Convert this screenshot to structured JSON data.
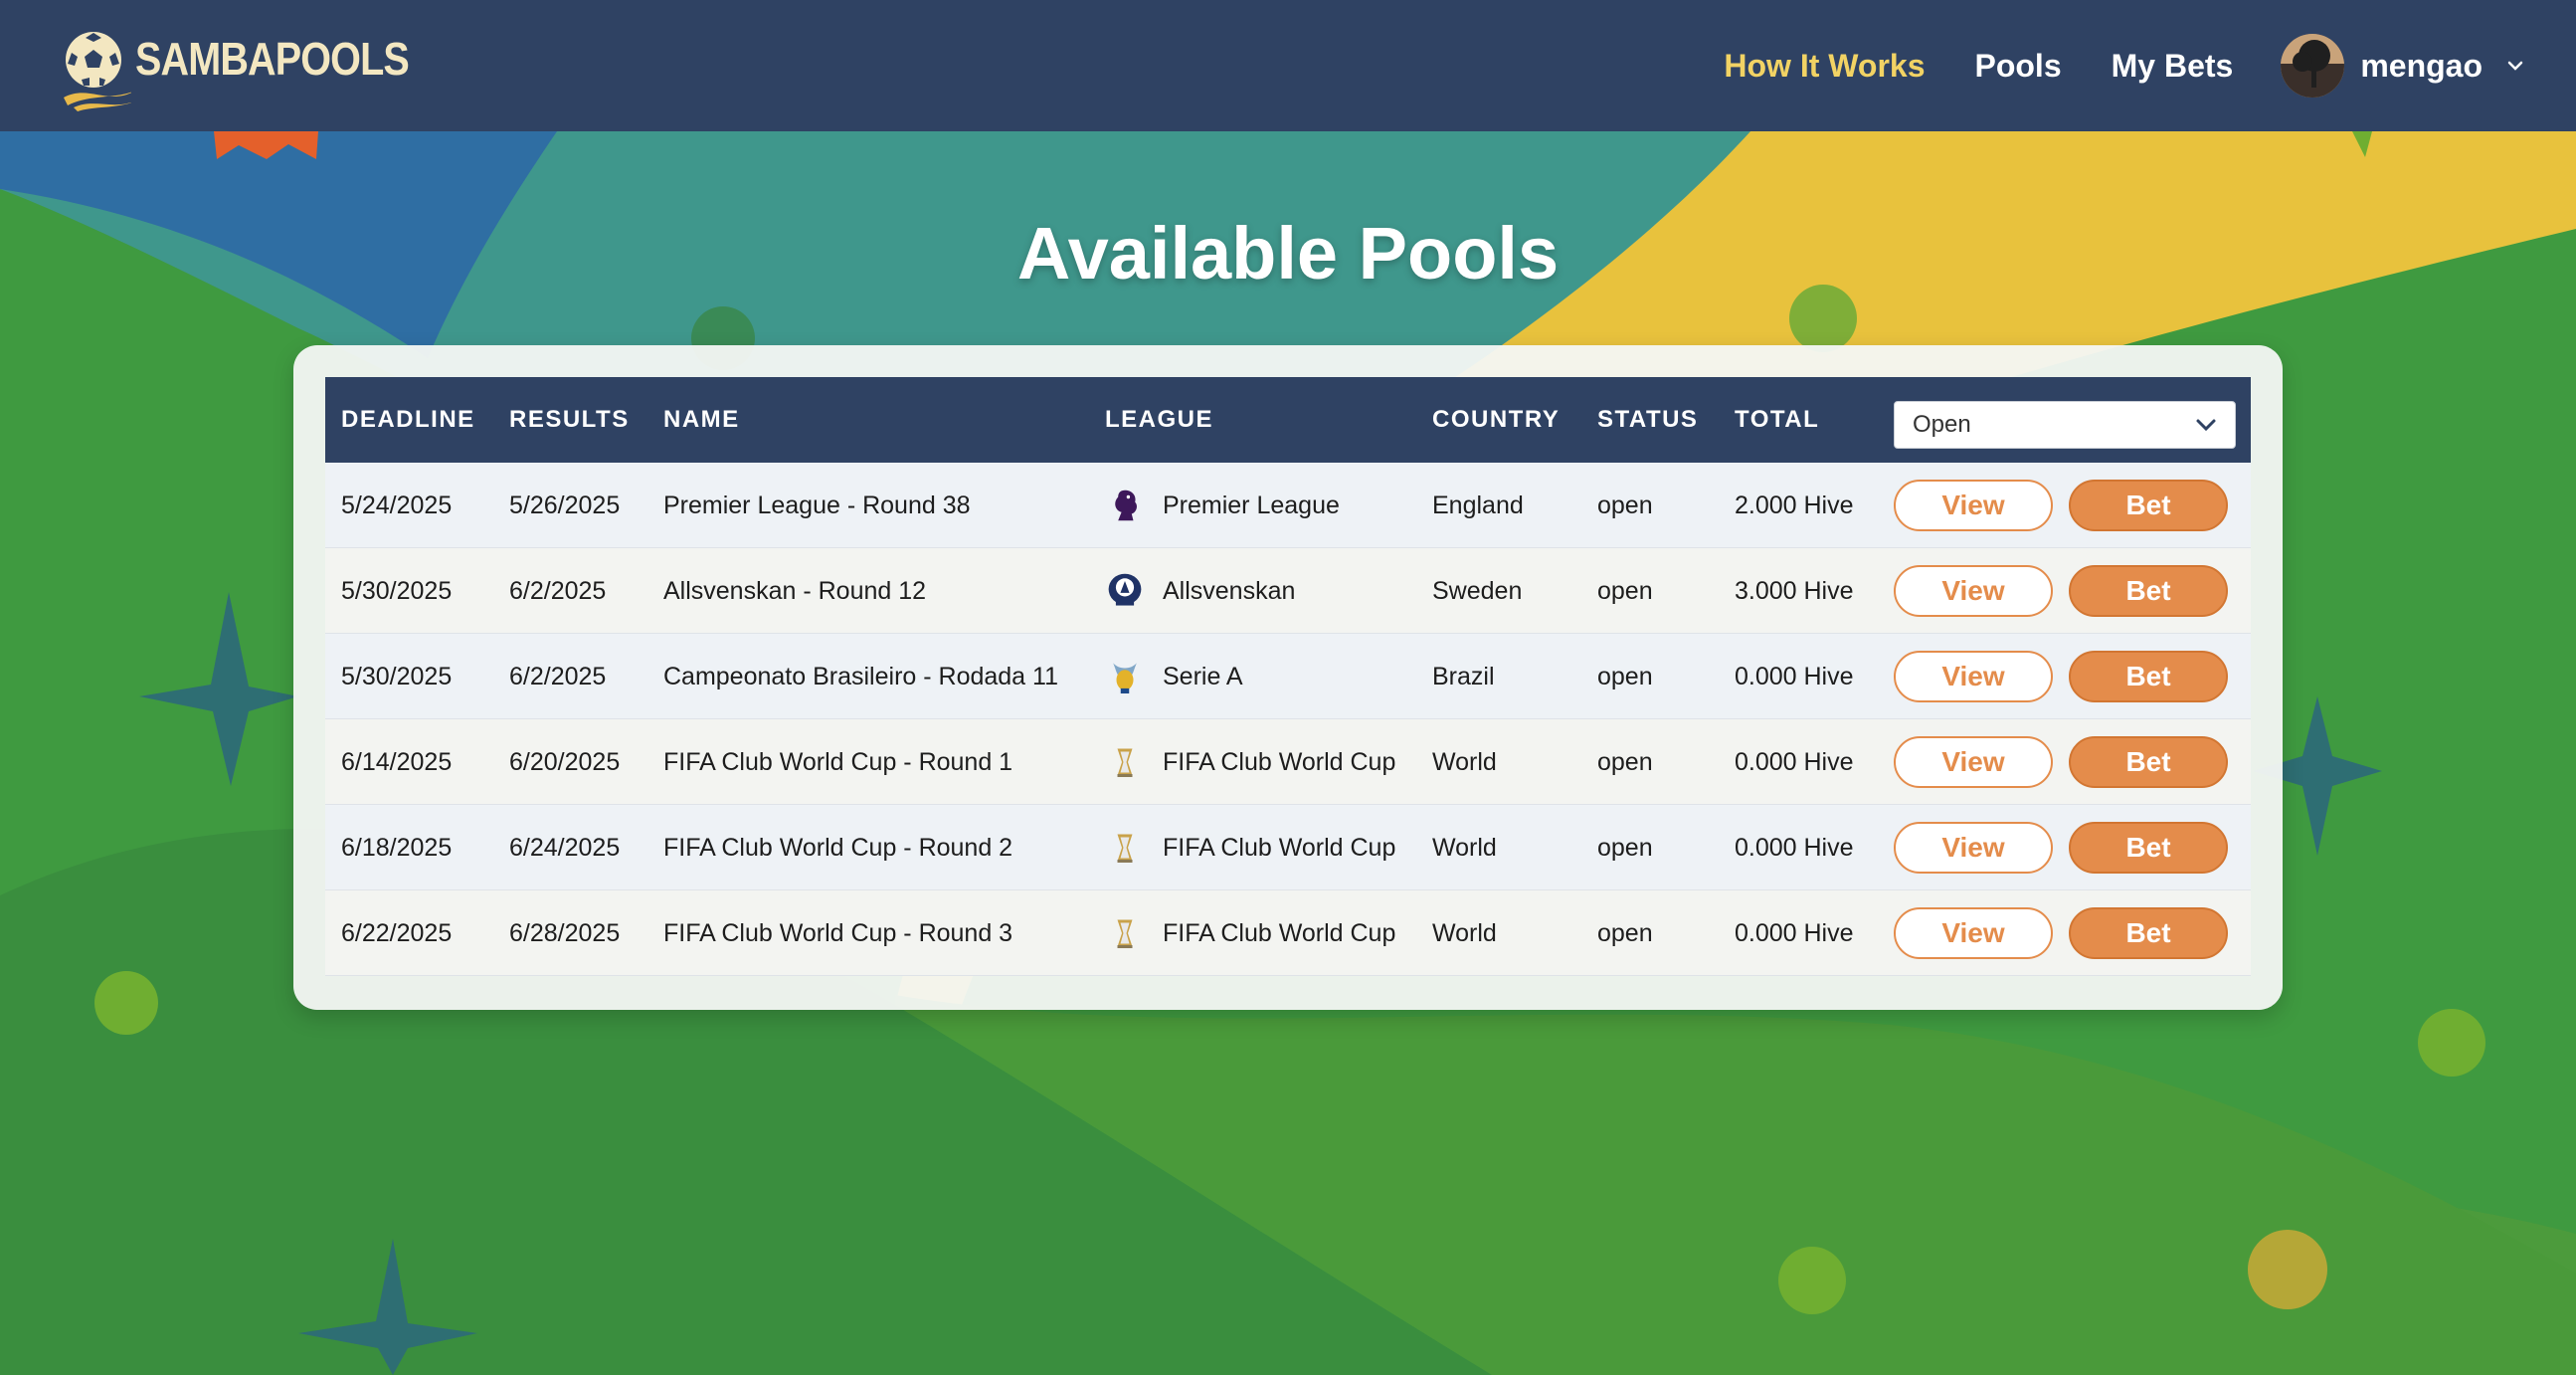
{
  "brand": {
    "name": "SAMBAPOOLS"
  },
  "nav": {
    "links": [
      {
        "label": "How It Works",
        "active": true
      },
      {
        "label": "Pools",
        "active": false
      },
      {
        "label": "My Bets",
        "active": false
      }
    ],
    "user": {
      "name": "mengao"
    }
  },
  "page": {
    "title": "Available Pools"
  },
  "table": {
    "headers": {
      "deadline": "DEADLINE",
      "results": "RESULTS",
      "name": "NAME",
      "league": "LEAGUE",
      "country": "COUNTRY",
      "status": "STATUS",
      "total": "TOTAL"
    },
    "filter": {
      "selected": "Open"
    },
    "actions": {
      "view": "View",
      "bet": "Bet"
    },
    "rows": [
      {
        "deadline": "5/24/2025",
        "results": "5/26/2025",
        "name": "Premier League - Round 38",
        "league": "Premier League",
        "league_icon": "premier-league-icon",
        "country": "England",
        "status": "open",
        "total": "2.000 Hive"
      },
      {
        "deadline": "5/30/2025",
        "results": "6/2/2025",
        "name": "Allsvenskan - Round 12",
        "league": "Allsvenskan",
        "league_icon": "allsvenskan-icon",
        "country": "Sweden",
        "status": "open",
        "total": "3.000 Hive"
      },
      {
        "deadline": "5/30/2025",
        "results": "6/2/2025",
        "name": "Campeonato Brasileiro - Rodada 11",
        "league": "Serie A",
        "league_icon": "serie-a-icon",
        "country": "Brazil",
        "status": "open",
        "total": "0.000 Hive"
      },
      {
        "deadline": "6/14/2025",
        "results": "6/20/2025",
        "name": "FIFA Club World Cup - Round 1",
        "league": "FIFA Club World Cup",
        "league_icon": "club-world-cup-icon",
        "country": "World",
        "status": "open",
        "total": "0.000 Hive"
      },
      {
        "deadline": "6/18/2025",
        "results": "6/24/2025",
        "name": "FIFA Club World Cup - Round 2",
        "league": "FIFA Club World Cup",
        "league_icon": "club-world-cup-icon",
        "country": "World",
        "status": "open",
        "total": "0.000 Hive"
      },
      {
        "deadline": "6/22/2025",
        "results": "6/28/2025",
        "name": "FIFA Club World Cup - Round 3",
        "league": "FIFA Club World Cup",
        "league_icon": "club-world-cup-icon",
        "country": "World",
        "status": "open",
        "total": "0.000 Hive"
      }
    ]
  },
  "colors": {
    "header_bg": "#2f4263",
    "nav_active": "#f2d364",
    "accent": "#e48c4b",
    "background_green": "#3f9a40",
    "background_yellow": "#e8c23d",
    "background_teal": "#3f9a8e"
  }
}
